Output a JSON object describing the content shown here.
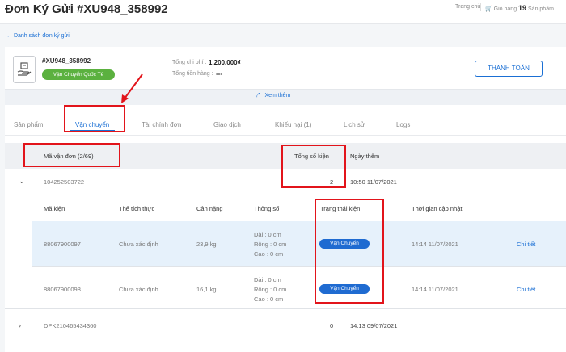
{
  "header": {
    "title": "Đơn Ký Gửi #XU948_358992",
    "home": "Trang chủ",
    "cart_label": "Giỏ hàng",
    "cart_count": "19",
    "products": "Sản phẩm"
  },
  "back_link": "Danh sách đơn ký gửi",
  "order": {
    "code": "#XU948_358992",
    "badge": "Vận Chuyển Quốc Tế",
    "total_cost_label": "Tổng chi phí :",
    "total_cost_value": "1.200.000₫",
    "goods_total_label": "Tổng tiền hàng :",
    "goods_total_value": "---",
    "pay_button": "THANH TOÁN",
    "more": "Xem thêm"
  },
  "tabs": [
    {
      "label": "Sản phẩm"
    },
    {
      "label": "Vận chuyển"
    },
    {
      "label": "Tài chính đơn"
    },
    {
      "label": "Giao dịch"
    },
    {
      "label": "Khiếu nại (1)"
    },
    {
      "label": "Lịch sử"
    },
    {
      "label": "Logs"
    }
  ],
  "table": {
    "headers": {
      "code": "Mã vận đơn (2/69)",
      "count": "Tổng số kiện",
      "added": "Ngày thêm"
    },
    "shipments": [
      {
        "code": "104252503722",
        "count": "2",
        "added": "10:50 11/07/2021"
      },
      {
        "code": "DPK210465434360",
        "count": "0",
        "added": "14:13 09/07/2021"
      }
    ],
    "package_headers": {
      "code": "Mã kiện",
      "volume": "Thể tích thực",
      "weight": "Cân nặng",
      "specs": "Thông số",
      "status": "Trạng thái kiện",
      "updated": "Thời gian cập nhật"
    },
    "packages": [
      {
        "code": "88067900097",
        "volume": "Chưa xác định",
        "weight": "23,9 kg",
        "length": "Dài : 0 cm",
        "width": "Rộng : 0 cm",
        "height": "Cao : 0 cm",
        "status": "Vận Chuyển",
        "updated": "14:14 11/07/2021",
        "detail": "Chi tiết"
      },
      {
        "code": "88067900098",
        "volume": "Chưa xác định",
        "weight": "16,1 kg",
        "length": "Dài : 0 cm",
        "width": "Rộng : 0 cm",
        "height": "Cao : 0 cm",
        "status": "Vận Chuyển",
        "updated": "14:14 11/07/2021",
        "detail": "Chi tiết"
      }
    ]
  },
  "colors": {
    "accent": "#1a6fd4",
    "badge_green": "#5bb13f",
    "annotation_red": "#e2141b"
  }
}
